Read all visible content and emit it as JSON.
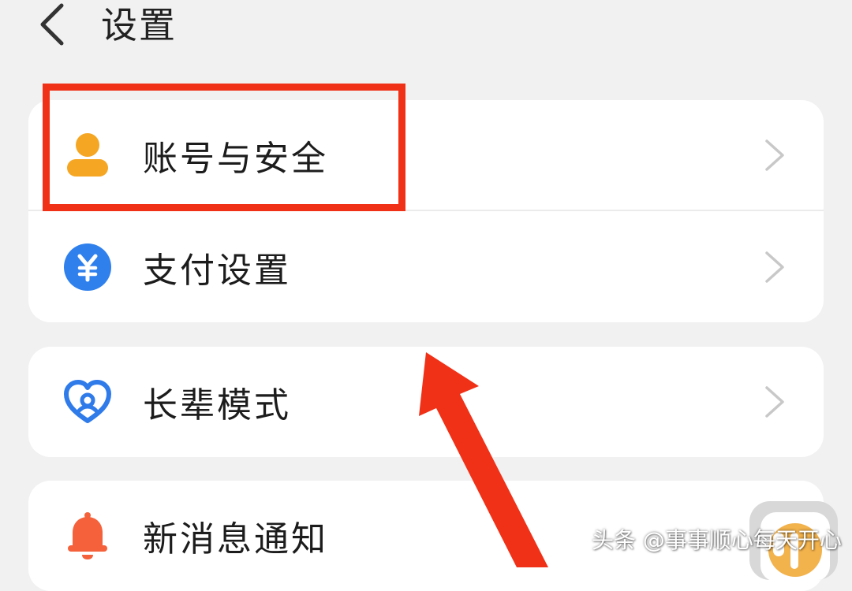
{
  "header": {
    "title": "设置"
  },
  "groups": [
    {
      "items": [
        {
          "label": "账号与安全",
          "icon": "person-icon",
          "icon_color": "#f5a623"
        },
        {
          "label": "支付设置",
          "icon": "yuan-icon",
          "icon_color": "#2f80ed"
        }
      ]
    },
    {
      "items": [
        {
          "label": "长辈模式",
          "icon": "heart-icon",
          "icon_color": "#2f7bea"
        }
      ]
    },
    {
      "items": [
        {
          "label": "新消息通知",
          "icon": "bell-icon",
          "icon_color": "#f4613a"
        }
      ]
    }
  ],
  "annotation": {
    "highlight_color": "#f03118"
  },
  "watermark": {
    "text": "头条 @事事顺心每天开心"
  },
  "colors": {
    "background": "#f1f1f1",
    "card": "#ffffff",
    "chevron": "#c8c8c8"
  }
}
